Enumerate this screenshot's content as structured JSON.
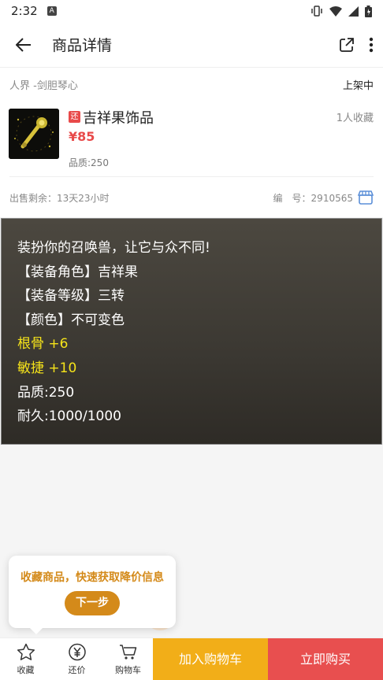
{
  "status_bar": {
    "time": "2:32",
    "notif_letter": "A"
  },
  "header": {
    "title": "商品详情"
  },
  "product": {
    "server": "人界 -剑胆琴心",
    "status": "上架中",
    "tag": "还",
    "name": "吉祥果饰品",
    "favorites": "1人收藏",
    "price": "¥85",
    "quality": "品质:250",
    "remaining": "出售剩余：13天23小时",
    "serial": "编　号：2910565"
  },
  "description": {
    "lines": [
      {
        "text": "装扮你的召唤兽，让它与众不同!",
        "color": "#ffffff"
      },
      {
        "text": "【装备角色】吉祥果",
        "color": "#ffffff"
      },
      {
        "text": "【装备等级】三转",
        "color": "#ffffff"
      },
      {
        "text": "【颜色】不可变色",
        "color": "#ffffff"
      },
      {
        "text": "根骨 +6",
        "color": "#f5e31a"
      },
      {
        "text": "敏捷 +10",
        "color": "#f5e31a"
      },
      {
        "text": "品质:250",
        "color": "#ffffff"
      },
      {
        "text": "耐久:1000/1000",
        "color": "#ffffff"
      }
    ]
  },
  "tooltip": {
    "text": "收藏商品，快速获取降价信息",
    "next_label": "下一步"
  },
  "bottom_bar": {
    "tabs": [
      {
        "label": "收藏",
        "icon": "star-icon"
      },
      {
        "label": "还价",
        "icon": "yen-icon"
      },
      {
        "label": "购物车",
        "icon": "cart-icon"
      }
    ],
    "add_cart_label": "加入购物车",
    "buy_now_label": "立即购买"
  },
  "colors": {
    "accent_orange": "#f2ae18",
    "accent_red": "#e84f4f",
    "tooltip_orange": "#d48a1a"
  }
}
